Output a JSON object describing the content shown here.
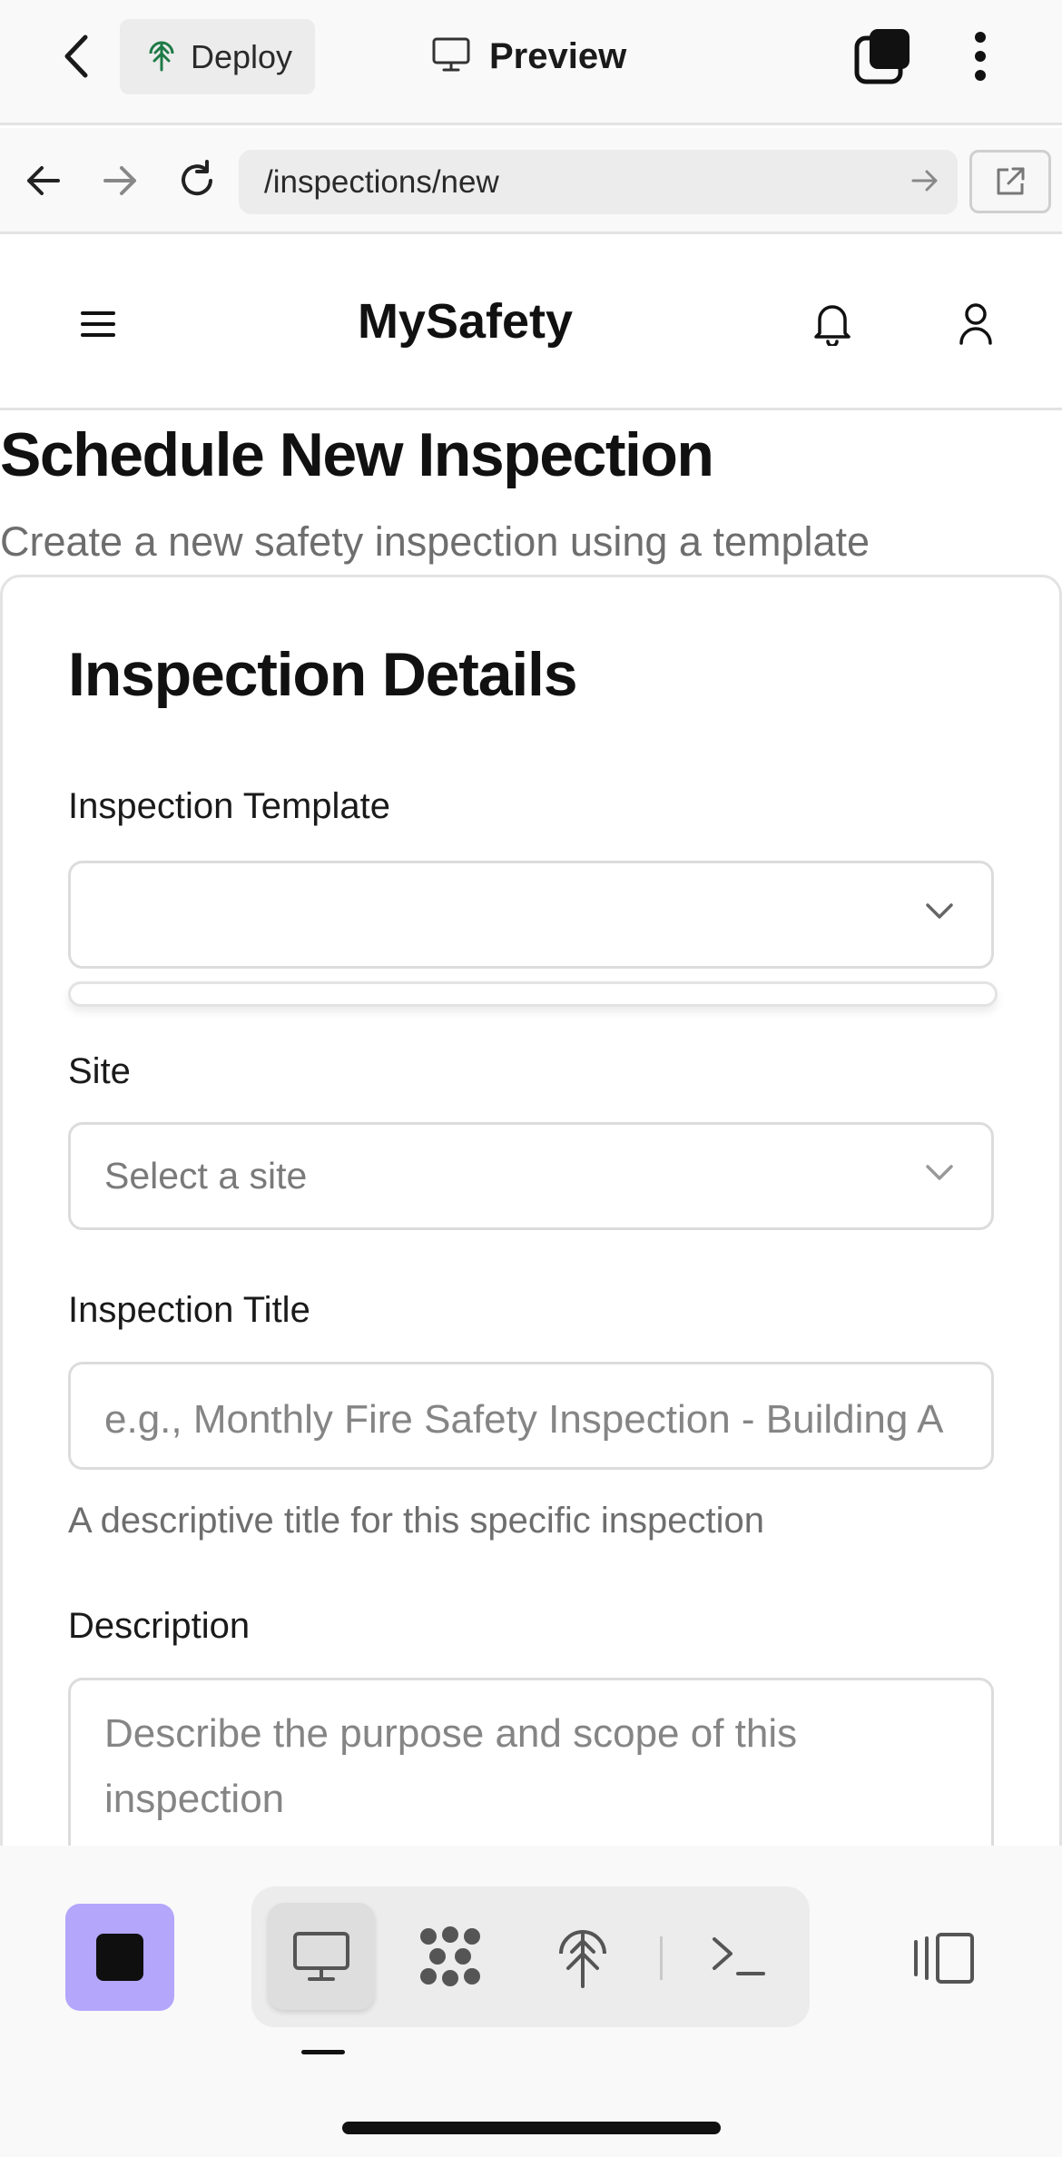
{
  "topbar": {
    "deploy_label": "Deploy",
    "preview_label": "Preview"
  },
  "browser": {
    "url": "/inspections/new"
  },
  "app": {
    "title": "MySafety"
  },
  "page": {
    "title": "Schedule New Inspection",
    "subtitle": "Create a new safety inspection using a template"
  },
  "form": {
    "card_title": "Inspection Details",
    "template_label": "Inspection Template",
    "template_value": "",
    "site_label": "Site",
    "site_placeholder": "Select a site",
    "title_label": "Inspection Title",
    "title_placeholder": "e.g., Monthly Fire Safety Inspection - Building A",
    "title_help": "A descriptive title for this specific inspection",
    "description_label": "Description",
    "description_placeholder_line1": "Describe the purpose and scope of this",
    "description_placeholder_line2": "inspection"
  },
  "toolbar": {
    "active_tab": "preview",
    "accent_color": "#b3a6fb"
  },
  "icons": [
    "chevron-left-icon",
    "deploy-icon",
    "monitor-icon",
    "tabs-icon",
    "more-vertical-icon",
    "arrow-left-icon",
    "arrow-right-icon",
    "reload-icon",
    "go-arrow-icon",
    "external-link-icon",
    "hamburger-icon",
    "bell-icon",
    "user-icon",
    "chevron-down-icon",
    "stop-icon",
    "desktop-icon",
    "grid-icon",
    "deploy-icon",
    "terminal-icon",
    "split-view-icon"
  ]
}
